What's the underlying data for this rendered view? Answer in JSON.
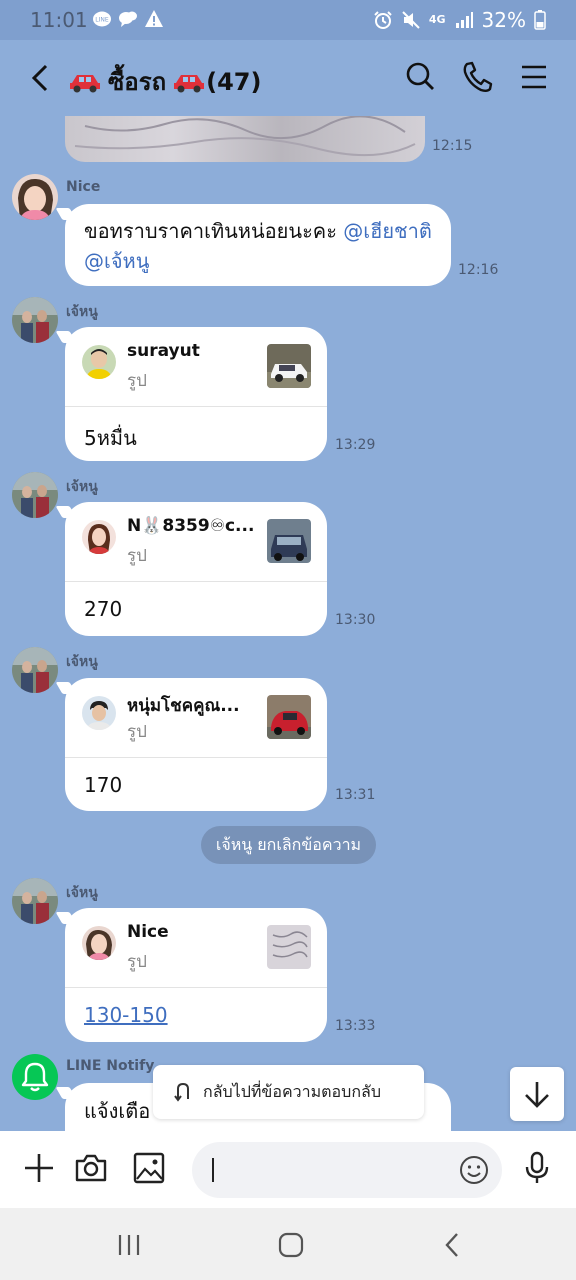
{
  "status_bar": {
    "time": "11:01",
    "network": "4G",
    "battery": "32%"
  },
  "header": {
    "title": "ซื้อรถ",
    "member_count": "(47)"
  },
  "messages": [
    {
      "id": "m0",
      "time": "12:15"
    },
    {
      "id": "m1",
      "sender": "Nice",
      "text": "ขอทราบราคาเทินหน่อยนะคะ ",
      "mention1": "@เฮียชาติ",
      "mention2": "@เจ้หนู",
      "time": "12:16"
    },
    {
      "id": "m2",
      "sender": "เจ้หนู",
      "reply_name": "surayut",
      "reply_type": "รูป",
      "text": "5หมื่น",
      "time": "13:29"
    },
    {
      "id": "m3",
      "sender": "เจ้หนู",
      "reply_name": "N🐰8359♾c...",
      "reply_type": "รูป",
      "text": "270",
      "time": "13:30"
    },
    {
      "id": "m4",
      "sender": "เจ้หนู",
      "reply_name": "หนุ่มโชคคูณ...",
      "reply_type": "รูป",
      "text": "170",
      "time": "13:31"
    },
    {
      "id": "m5",
      "sender": "เจ้หนู",
      "reply_name": "Nice",
      "reply_type": "รูป",
      "text": "130-150",
      "time": "13:33"
    },
    {
      "id": "m6",
      "sender": "LINE Notify",
      "text": "แจ้งเตือ"
    }
  ],
  "system_message": "เจ้หนู ยกเลิกข้อความ",
  "toast": "กลับไปที่ข้อความตอบกลับ",
  "input": {
    "value": "",
    "placeholder": ""
  },
  "colors": {
    "chat_background": "#8dadd9",
    "mention": "#3f6ebf",
    "line_green": "#06c755"
  }
}
